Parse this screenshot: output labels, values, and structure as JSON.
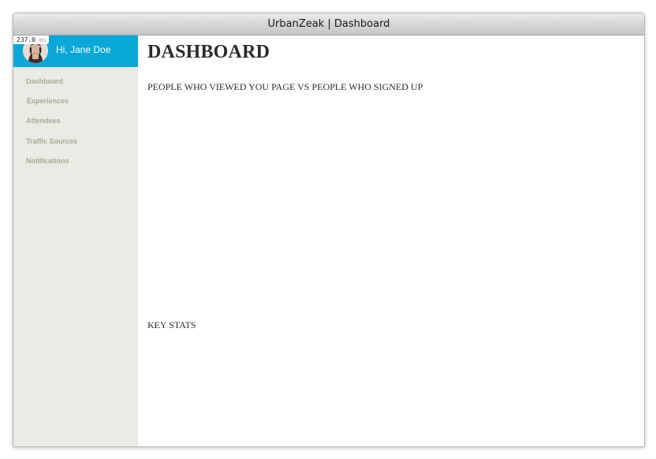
{
  "window": {
    "title": "UrbanZeak | Dashboard"
  },
  "perf_badge": {
    "value": "237.0",
    "unit": "ms"
  },
  "user": {
    "greeting": "Hi, Jane Doe"
  },
  "sidebar": {
    "items": [
      {
        "label": "Dashboard"
      },
      {
        "label": "Experiences"
      },
      {
        "label": "Attendees"
      },
      {
        "label": "Traffic Sources"
      },
      {
        "label": "Notifications"
      }
    ]
  },
  "main": {
    "page_title": "DASHBOARD",
    "chart_heading": "PEOPLE WHO VIEWED YOU PAGE VS PEOPLE WHO SIGNED UP",
    "stats_heading": "KEY STATS"
  },
  "colors": {
    "accent": "#0aa8d8",
    "sidebar_bg": "#ebeae4",
    "nav_text": "#a9ab8f"
  }
}
